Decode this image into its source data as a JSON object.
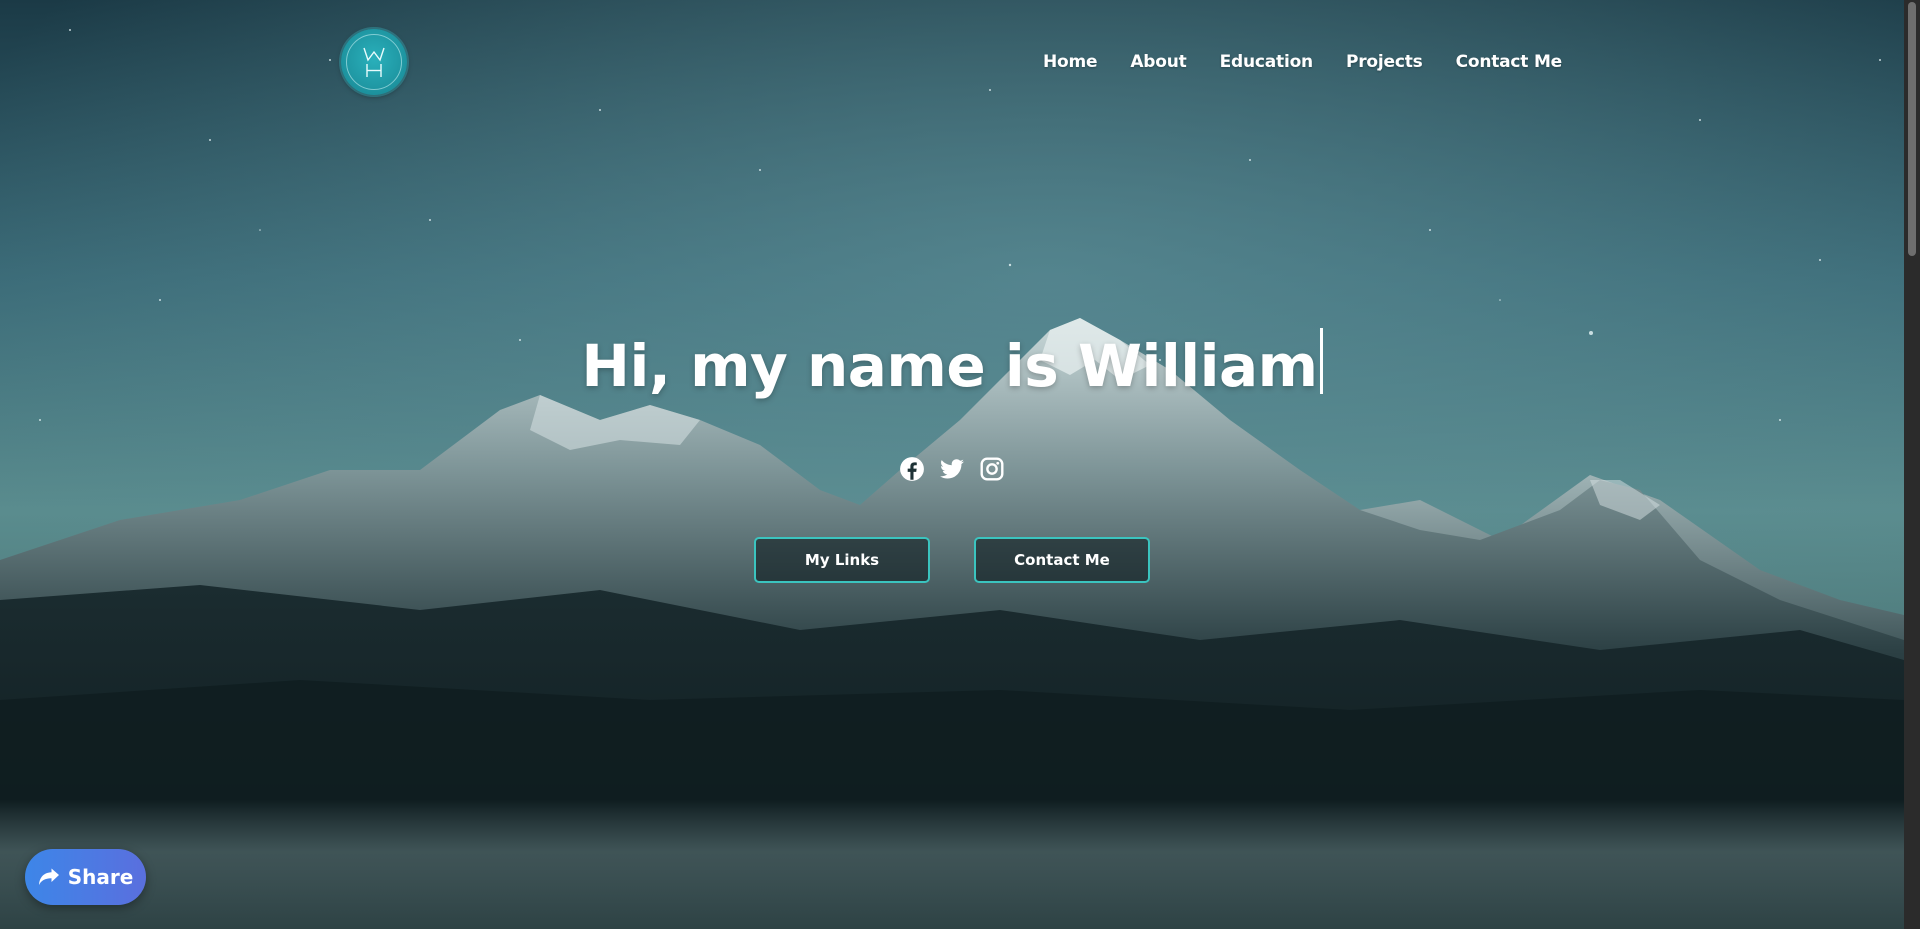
{
  "header": {
    "logo_alt": "WH",
    "nav": [
      {
        "label": "Home"
      },
      {
        "label": "About"
      },
      {
        "label": "Education"
      },
      {
        "label": "Projects"
      },
      {
        "label": "Contact Me"
      }
    ]
  },
  "hero": {
    "title": "Hi, my name is William",
    "socials": [
      {
        "icon": "facebook-icon"
      },
      {
        "icon": "twitter-icon"
      },
      {
        "icon": "instagram-icon"
      }
    ],
    "buttons": {
      "links_label": "My Links",
      "contact_label": "Contact Me"
    }
  },
  "share": {
    "label": "Share",
    "icon": "share-arrow-icon"
  },
  "colors": {
    "accent": "#3bc4bf",
    "logo": "#1f97a3",
    "share_start": "#3d86e8",
    "share_end": "#5a6fde"
  }
}
